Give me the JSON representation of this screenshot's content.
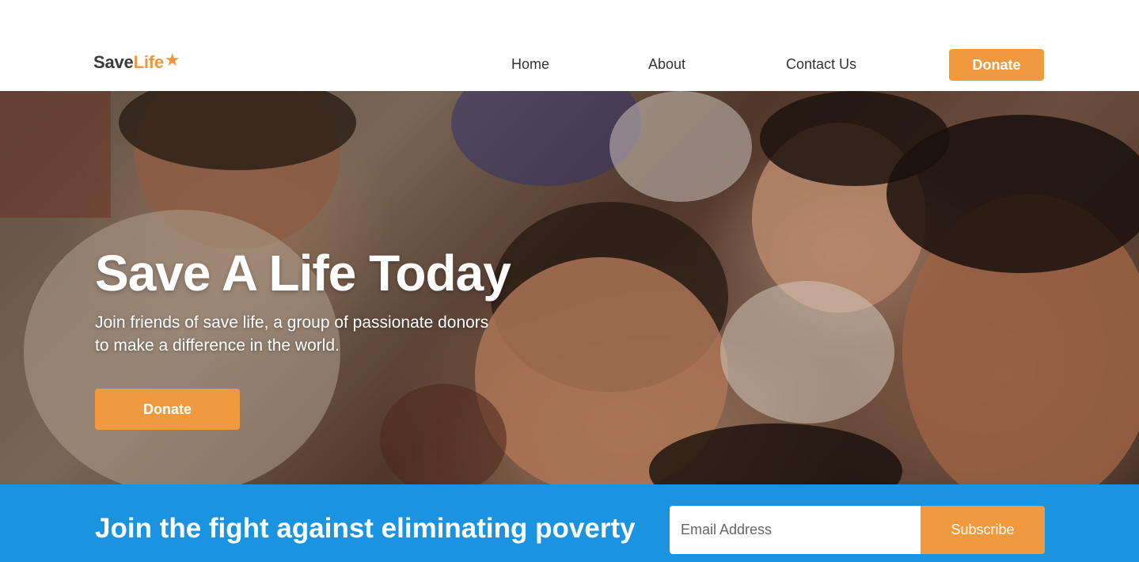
{
  "header": {
    "logo": {
      "part1": "Save",
      "part2": "Life",
      "icon": "star-icon"
    },
    "nav": [
      {
        "label": "Home"
      },
      {
        "label": "About"
      },
      {
        "label": "Contact Us"
      }
    ],
    "donate_label": "Donate"
  },
  "hero": {
    "title": "Save A Life Today",
    "subtitle": "Join friends of save life, a group of passionate donors to make a difference in the world.",
    "donate_label": "Donate"
  },
  "subscribe": {
    "title": "Join the fight against eliminating poverty",
    "email_placeholder": "Email Address",
    "button_label": "Subscribe"
  },
  "colors": {
    "accent_orange": "#f0993f",
    "band_blue": "#1a93e0",
    "text_dark": "#333333"
  }
}
